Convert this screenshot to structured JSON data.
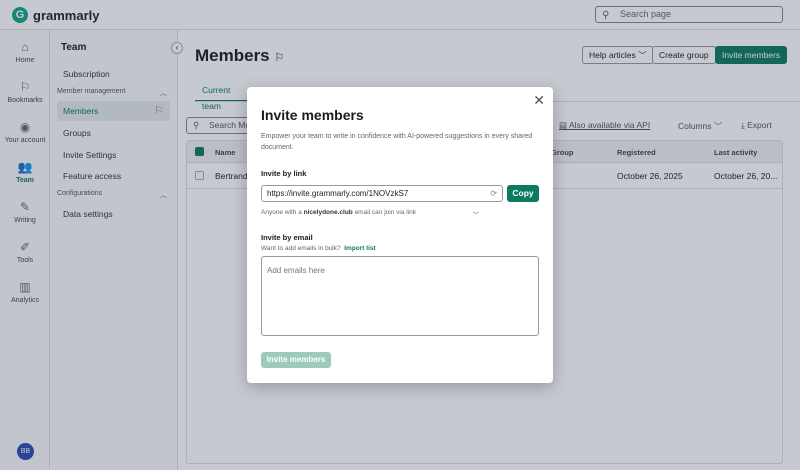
{
  "app": {
    "logo": "grammarly",
    "search_placeholder": "Search page"
  },
  "nav": [
    {
      "label": "Home",
      "icon": "⌂"
    },
    {
      "label": "Bookmarks",
      "icon": "⚐"
    },
    {
      "label": "Your account",
      "icon": "◉"
    },
    {
      "label": "Team",
      "icon": "👥"
    },
    {
      "label": "Writing",
      "icon": "✎"
    },
    {
      "label": "Tools",
      "icon": "✐"
    },
    {
      "label": "Analytics",
      "icon": "▥"
    }
  ],
  "avatar": "BB",
  "sidebar": {
    "title": "Team",
    "subscription": "Subscription",
    "sec_member": "Member management",
    "members": "Members",
    "groups": "Groups",
    "invite_settings": "Invite Settings",
    "feature_access": "Feature access",
    "sec_config": "Configurations",
    "data_settings": "Data settings"
  },
  "main": {
    "title": "Members",
    "help": "Help articles",
    "create_group": "Create group",
    "invite_members": "Invite members",
    "tab": "Current team",
    "search": "Search Me",
    "api": "Also available via API",
    "columns": "Columns",
    "export": "Export"
  },
  "table": {
    "headers": {
      "name": "Name",
      "group": "Group",
      "registered": "Registered",
      "last_activity": "Last activity"
    },
    "rows": [
      {
        "name": "Bertrand",
        "registered": "October 26, 2025",
        "last_activity": "October 26, 20..."
      }
    ]
  },
  "modal": {
    "title": "Invite members",
    "desc": "Empower your team to write in confidence with AI-powered suggestions in every shared document.",
    "link_label": "Invite by link",
    "link": "https://invite.grammarly.com/1NOVzkS7",
    "copy": "Copy",
    "domain_prefix": "Anyone with a ",
    "domain": "nicelydone.club",
    "domain_suffix": " email can join via link",
    "email_label": "Invite by email",
    "bulk": "Want to add emails in bulk?",
    "import": "Import list",
    "email_placeholder": "Add emails here",
    "invite": "Invite members"
  }
}
